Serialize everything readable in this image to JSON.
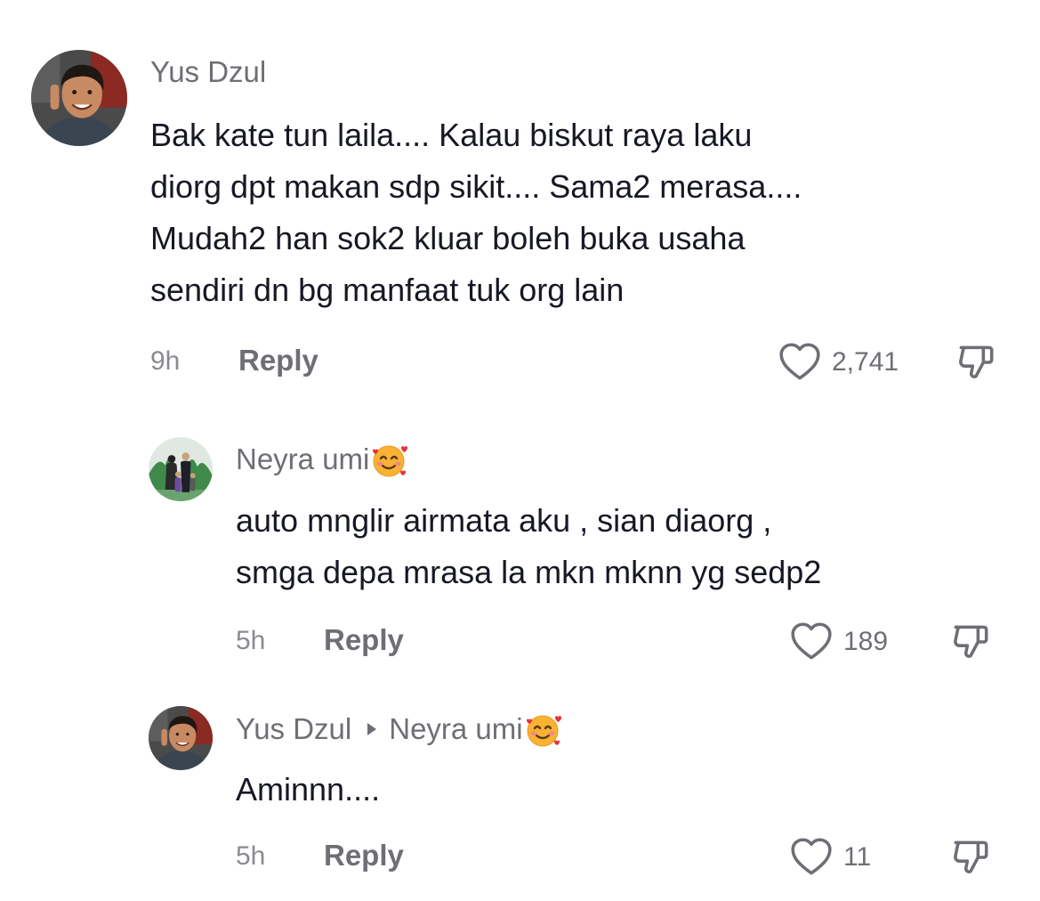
{
  "colors": {
    "text": "#161823",
    "secondary": "#6e6f75",
    "muted": "#8a8b91"
  },
  "comments": [
    {
      "username": "Yus Dzul",
      "lines": [
        "Bak kate tun laila.... Kalau biskut raya laku",
        "diorg dpt makan sdp sikit.... Sama2 merasa....",
        "Mudah2 han sok2 kluar boleh buka usaha",
        "sendiri dn bg manfaat tuk org lain"
      ],
      "time": "9h",
      "reply_label": "Reply",
      "likes": "2,741",
      "avatar_icon": "boy-portrait-avatar"
    },
    {
      "username": "Neyra umi",
      "username_emoji": "smiling-face-with-hearts-emoji",
      "lines": [
        "auto mnglir airmata aku , sian diaorg ,",
        "smga depa mrasa la mkn mknn yg sedp2"
      ],
      "time": "5h",
      "reply_label": "Reply",
      "likes": "189",
      "avatar_icon": "family-portrait-avatar"
    },
    {
      "username": "Yus Dzul",
      "reply_to": "Neyra umi",
      "reply_to_emoji": "smiling-face-with-hearts-emoji",
      "lines": [
        "Aminnn...."
      ],
      "time": "5h",
      "reply_label": "Reply",
      "likes": "11",
      "avatar_icon": "boy-portrait-avatar"
    }
  ]
}
